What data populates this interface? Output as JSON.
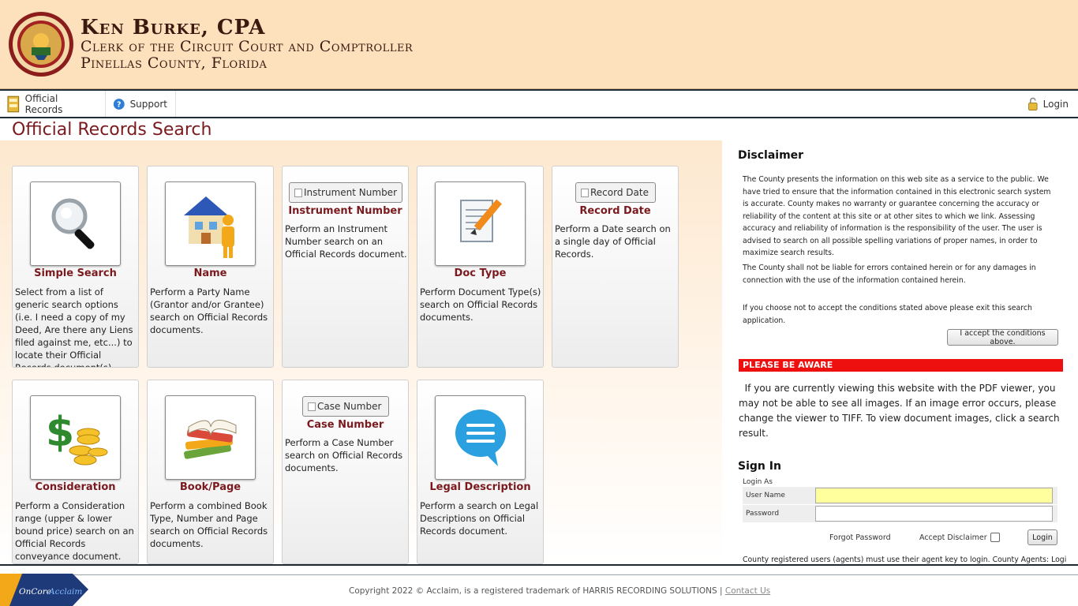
{
  "header": {
    "name": "Ken Burke, CPA",
    "subtitle1": "Clerk of the Circuit Court and Comptroller",
    "subtitle2": "Pinellas County, Florida"
  },
  "nav": {
    "official_records": "Official Records",
    "support": "Support",
    "login": "Login"
  },
  "page_title": "Official Records Search",
  "cards": [
    {
      "title": "Simple Search",
      "desc": "Select from a list of generic search options (i.e. I need a copy of my Deed, Are there any Liens filed against me, etc...) to locate their Official Records document(s)."
    },
    {
      "title": "Name",
      "desc": "Perform a Party Name (Grantor and/or Grantee) search on Official Records documents."
    },
    {
      "title": "Instrument Number",
      "alt": "Instrument Number",
      "desc": "Perform an Instrument Number search on an Official Records document."
    },
    {
      "title": "Doc Type",
      "desc": "Perform Document Type(s) search on Official Records documents."
    },
    {
      "title": "Record Date",
      "alt": "Record Date",
      "desc": "Perform a Date search on a single day of Official Records."
    },
    {
      "title": "Consideration",
      "desc": "Perform a Consideration range (upper & lower bound price) search on an Official Records conveyance document."
    },
    {
      "title": "Book/Page",
      "desc": "Perform a combined Book Type, Number and Page search on Official Records documents."
    },
    {
      "title": "Case Number",
      "alt": "Case Number",
      "desc": "Perform a Case Number search on Official Records documents."
    },
    {
      "title": "Legal Description",
      "desc": "Perform a search on Legal Descriptions on Official Records document."
    }
  ],
  "disclaimer": {
    "heading": "Disclaimer",
    "p1": "The County presents the information on this web site as a service to the public. We have tried to ensure that the information contained in this electronic search system is accurate. County makes no warranty or guarantee concerning the accuracy or reliability of the content at this site or at other sites to which we link. Assessing accuracy and reliability of information is the responsibility of the user. The user is advised to search on all possible spelling variations of proper names, in order to maximize search results.",
    "p2": "The County shall not be liable for errors contained herein or for any damages in connection with the use of the information contained herein.",
    "p3": "If you choose not to accept the conditions stated above please exit this search application.",
    "accept_button": "I accept the conditions above."
  },
  "aware": {
    "heading": "PLEASE BE AWARE",
    "text": "If you are currently viewing this website with the PDF viewer, you may not be able to see all images. If an image error occurs, please change the viewer to TIFF. To view document images, click a search result."
  },
  "signin": {
    "heading": "Sign In",
    "login_as": "Login As",
    "username_label": "User Name",
    "password_label": "Password",
    "forgot": "Forgot Password",
    "accept_disclaimer": "Accept Disclaimer",
    "login_button": "Login",
    "agent_note": "County registered users (agents) must use their agent key to login. County Agents: Login"
  },
  "footer": {
    "copyright": "Copyright 2022 © Acclaim, is a registered trademark of HARRIS RECORDING SOLUTIONS |",
    "contact": "Contact Us",
    "logo_text_a": "OnCore",
    "logo_text_b": "Acclaim"
  },
  "colors": {
    "header_bg": "#fde1bd",
    "title_maroon": "#7a1a1e",
    "aware_red": "#ee0f0f",
    "username_yellow": "#ffff9e"
  }
}
